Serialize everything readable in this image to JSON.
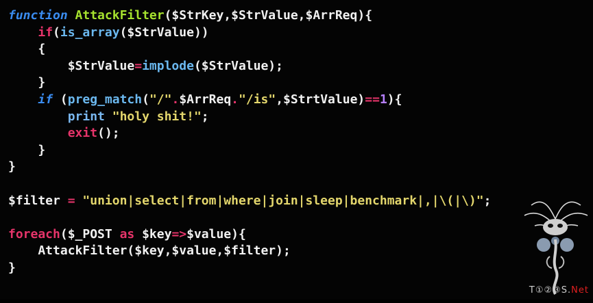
{
  "code": {
    "lines": [
      [
        {
          "t": "function",
          "c": "t-keyword"
        },
        {
          "t": " ",
          "c": "t-plain"
        },
        {
          "t": "AttackFilter",
          "c": "t-fname"
        },
        {
          "t": "($StrKey,$StrValue,$ArrReq){",
          "c": "t-plain"
        }
      ],
      [
        {
          "t": "    ",
          "c": "t-plain"
        },
        {
          "t": "if",
          "c": "t-builtin"
        },
        {
          "t": "(",
          "c": "t-plain"
        },
        {
          "t": "is_array",
          "c": "t-func"
        },
        {
          "t": "($StrValue))",
          "c": "t-plain"
        }
      ],
      [
        {
          "t": "    {",
          "c": "t-plain"
        }
      ],
      [
        {
          "t": "        $StrValue",
          "c": "t-plain"
        },
        {
          "t": "=",
          "c": "t-op"
        },
        {
          "t": "implode",
          "c": "t-func"
        },
        {
          "t": "($StrValue);",
          "c": "t-plain"
        }
      ],
      [
        {
          "t": "    }",
          "c": "t-plain"
        }
      ],
      [
        {
          "t": "    ",
          "c": "t-plain"
        },
        {
          "t": "if",
          "c": "t-keyword"
        },
        {
          "t": " (",
          "c": "t-plain"
        },
        {
          "t": "preg_match",
          "c": "t-func"
        },
        {
          "t": "(",
          "c": "t-plain"
        },
        {
          "t": "\"/\"",
          "c": "t-string"
        },
        {
          "t": ".",
          "c": "t-op"
        },
        {
          "t": "$ArrReq",
          "c": "t-plain"
        },
        {
          "t": ".",
          "c": "t-op"
        },
        {
          "t": "\"/is\"",
          "c": "t-string"
        },
        {
          "t": ",$StrtValue)",
          "c": "t-plain"
        },
        {
          "t": "==",
          "c": "t-op"
        },
        {
          "t": "1",
          "c": "t-num"
        },
        {
          "t": "){",
          "c": "t-plain"
        }
      ],
      [
        {
          "t": "        ",
          "c": "t-plain"
        },
        {
          "t": "print",
          "c": "t-print"
        },
        {
          "t": " ",
          "c": "t-plain"
        },
        {
          "t": "\"holy shit!\"",
          "c": "t-string"
        },
        {
          "t": ";",
          "c": "t-plain"
        }
      ],
      [
        {
          "t": "        ",
          "c": "t-plain"
        },
        {
          "t": "exit",
          "c": "t-builtin"
        },
        {
          "t": "();",
          "c": "t-plain"
        }
      ],
      [
        {
          "t": "    }",
          "c": "t-plain"
        }
      ],
      [
        {
          "t": "}",
          "c": "t-plain"
        }
      ],
      [],
      [
        {
          "t": "$filter",
          "c": "t-plain"
        },
        {
          "t": " ",
          "c": "t-plain"
        },
        {
          "t": "=",
          "c": "t-op"
        },
        {
          "t": " ",
          "c": "t-plain"
        },
        {
          "t": "\"union|select|from|where|join|sleep|benchmark|,|\\(|\\)\"",
          "c": "t-string"
        },
        {
          "t": ";",
          "c": "t-plain"
        }
      ],
      [],
      [
        {
          "t": "foreach",
          "c": "t-builtin"
        },
        {
          "t": "($_POST ",
          "c": "t-plain"
        },
        {
          "t": "as",
          "c": "t-builtin"
        },
        {
          "t": " $key",
          "c": "t-plain"
        },
        {
          "t": "=>",
          "c": "t-op"
        },
        {
          "t": "$value){",
          "c": "t-plain"
        }
      ],
      [
        {
          "t": "    AttackFilter($key,$value,$filter);",
          "c": "t-plain"
        }
      ],
      [
        {
          "t": "}",
          "c": "t-plain"
        }
      ]
    ]
  },
  "watermark": {
    "prefix": "T①②③S.",
    "net": "Net"
  }
}
